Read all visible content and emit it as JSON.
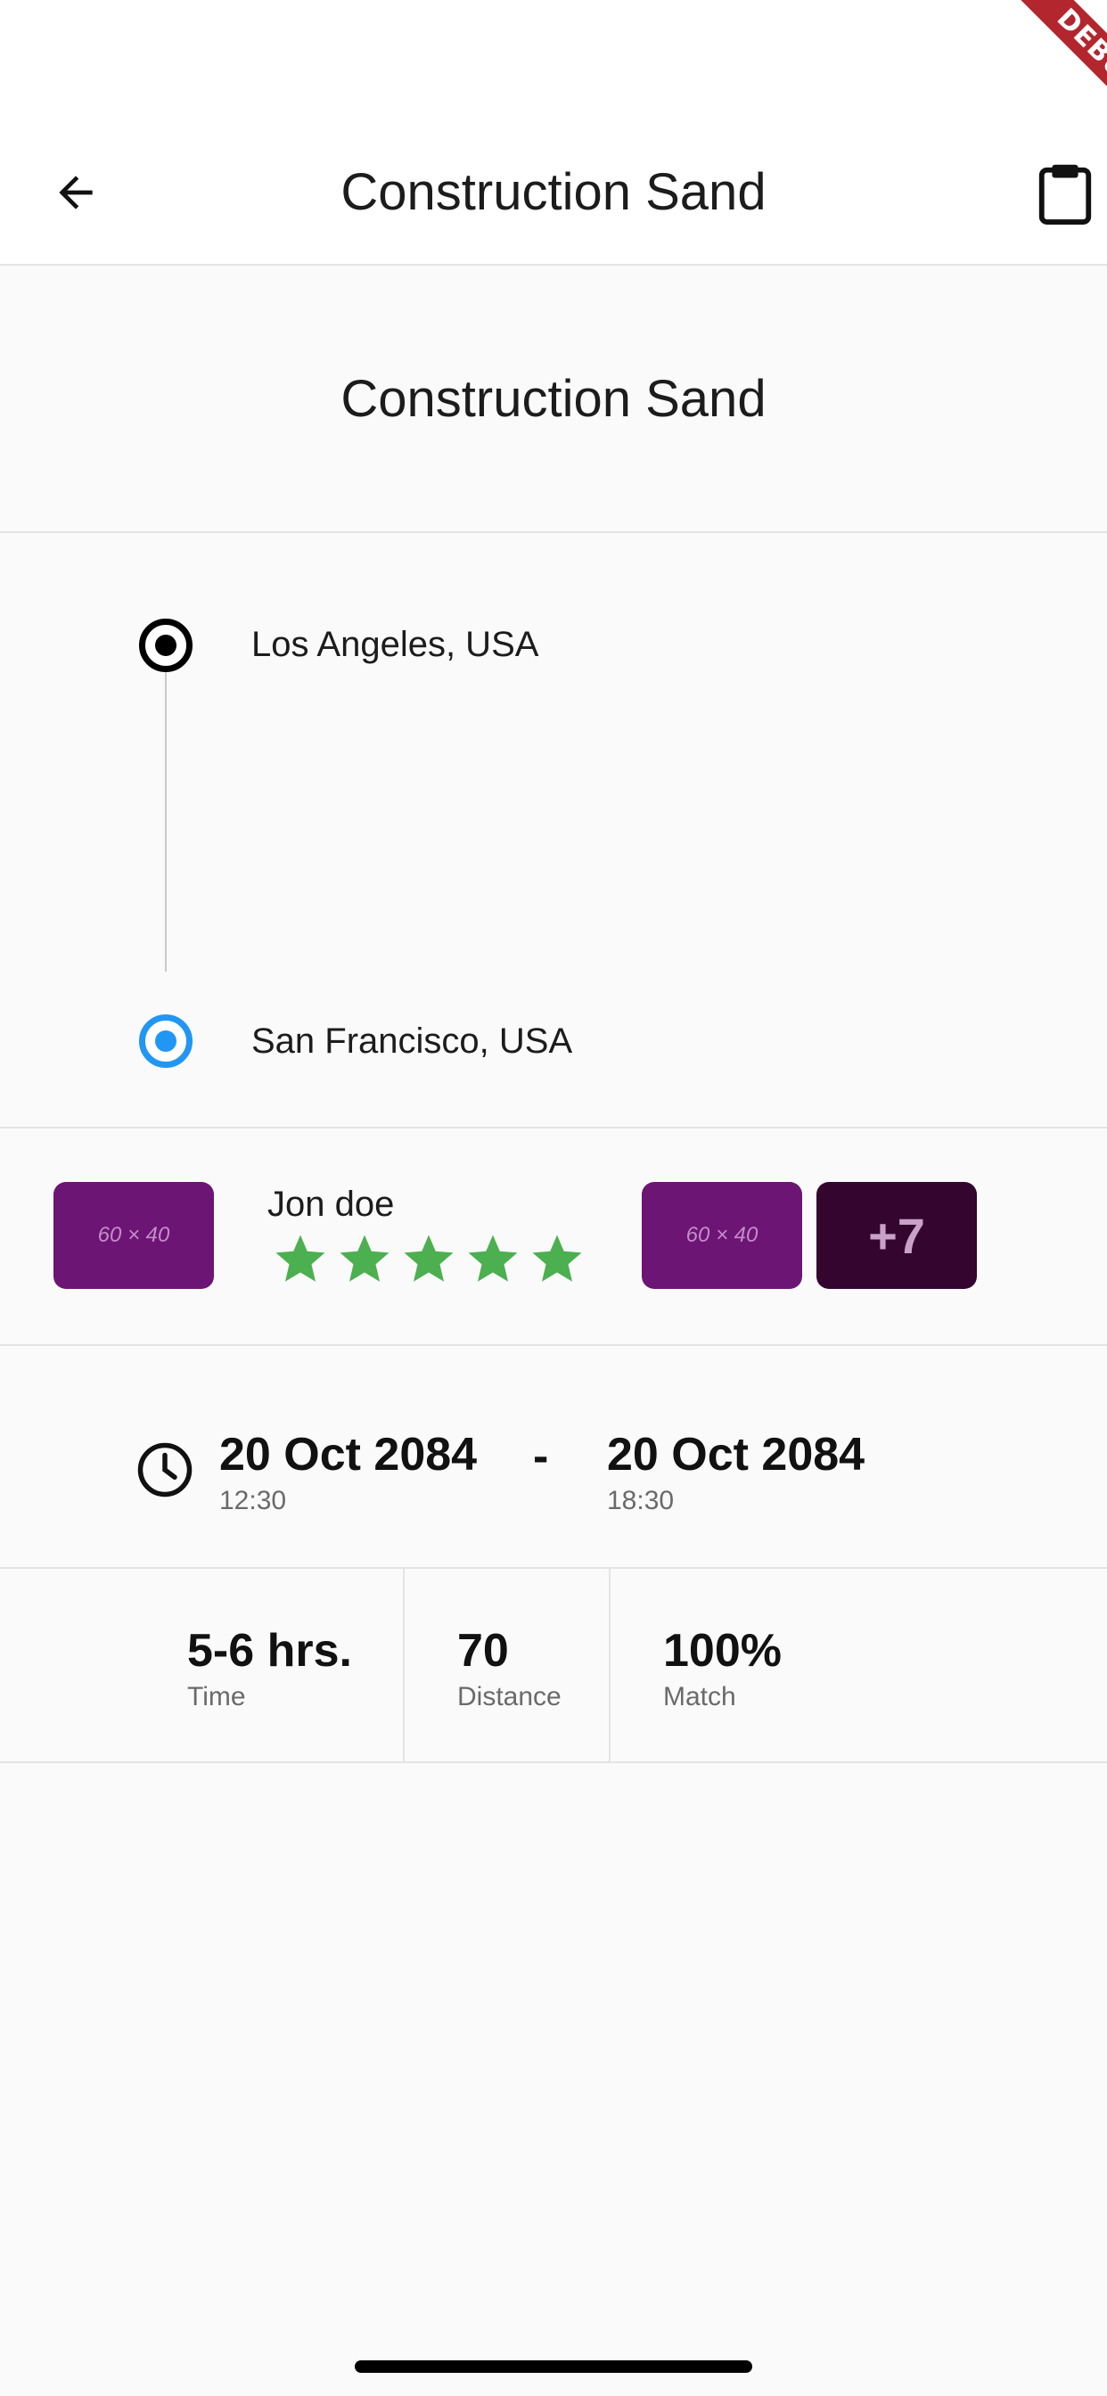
{
  "appbar": {
    "title": "Construction Sand",
    "back_icon": "arrow-left-icon",
    "clipboard_icon": "clipboard-icon"
  },
  "debug_banner": "DEBUG",
  "section": {
    "title": "Construction Sand"
  },
  "route": {
    "origin": "Los Angeles, USA",
    "destination": "San Francisco, USA",
    "origin_color": "#000000",
    "destination_color": "#2196f3"
  },
  "driver": {
    "name": "Jon doe",
    "rating": 5,
    "rating_max": 5,
    "star_color": "#4caf50",
    "thumb_placeholder": "60 × 40",
    "more_count": "+7",
    "thumb_color": "#6c1575",
    "more_color": "#33052f"
  },
  "schedule": {
    "start_date": "20 Oct 2084",
    "start_time": "12:30",
    "separator": "-",
    "end_date": "20 Oct 2084",
    "end_time": "18:30"
  },
  "stats": [
    {
      "value": "5-6 hrs.",
      "label": "Time"
    },
    {
      "value": "70",
      "label": "Distance"
    },
    {
      "value": "100%",
      "label": "Match"
    }
  ]
}
